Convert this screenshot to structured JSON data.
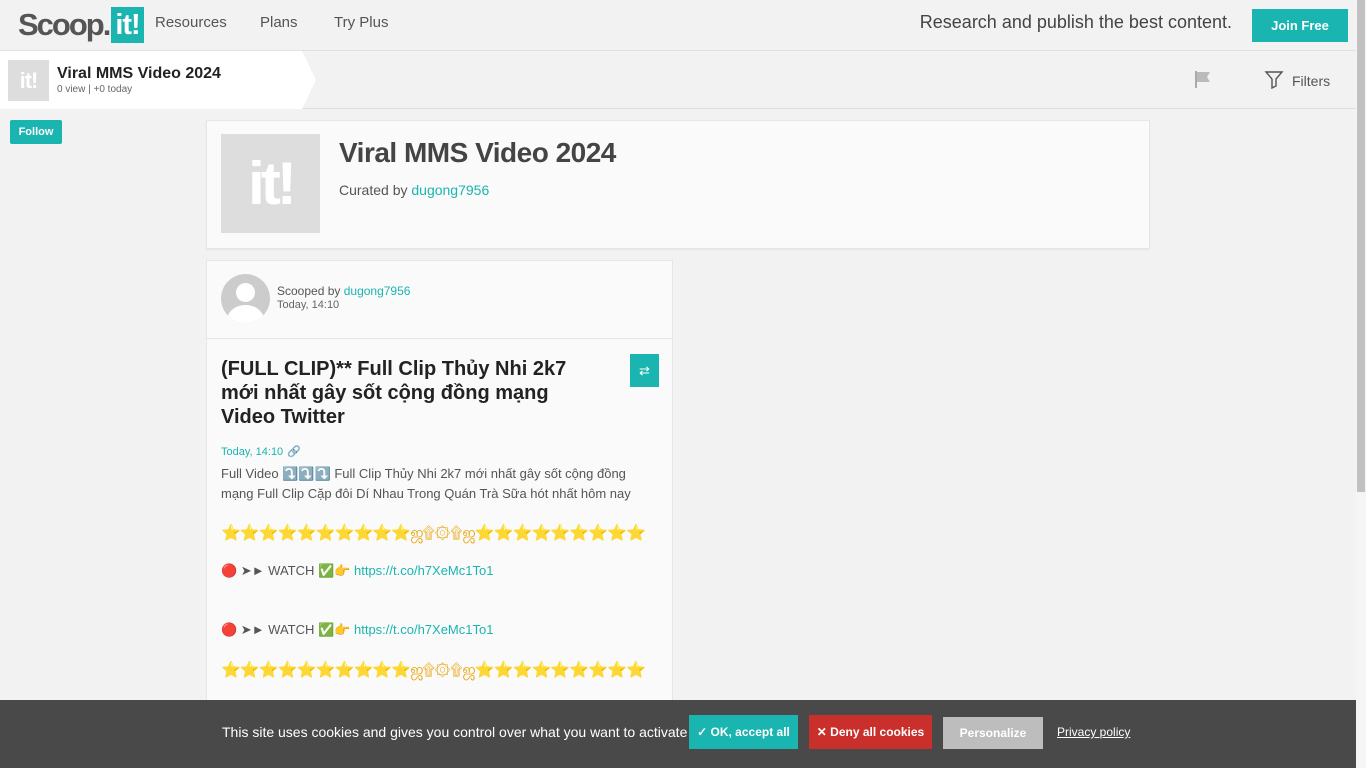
{
  "nav": {
    "logo_text": "Scoop.",
    "logo_box": "it!",
    "links": [
      "Resources",
      "Plans",
      "Try Plus"
    ],
    "tagline": "Research and publish the best content.",
    "join_label": "Join Free"
  },
  "topic": {
    "thumb_text": "it!",
    "title": "Viral MMS Video 2024",
    "stats": "0 view | +0 today",
    "filters_label": "Filters",
    "follow_label": "Follow"
  },
  "header": {
    "thumb_text": "it!",
    "title": "Viral MMS Video 2024",
    "curated_prefix": "Curated by ",
    "curator": "dugong7956"
  },
  "post": {
    "scooped_prefix": "Scooped by ",
    "scooper": "dugong7956",
    "scooped_time": "Today, 14:10",
    "title": "(FULL CLIP)** Full Clip Thủy Nhi 2k7 mới nhất gây sốt cộng đồng mạng Video Twitter",
    "date": "Today, 14:10",
    "description": "Full Video ⤵️⤵️⤵️ Full Clip Thủy Nhi 2k7 mới nhất gây sốt cộng đồng mạng Full Clip Cặp đôi Dí Nhau Trong Quán Trà Sữa hót nhất hôm nay",
    "deco_line": "⭐⭐⭐⭐⭐⭐⭐⭐⭐⭐ஜ۩۞۩ஜ⭐⭐⭐⭐⭐⭐⭐⭐⭐",
    "watch_prefix": "🔴 ➤► WATCH ✅👉 ",
    "watch_link": "https://t.co/h7XeMc1To1"
  },
  "cookie": {
    "text": "This site uses cookies and gives you control over what you want to activate",
    "ok_label": "✓ OK, accept all",
    "deny_label": "✕ Deny all cookies",
    "personalize_label": "Personalize",
    "privacy_label": "Privacy policy"
  },
  "colors": {
    "accent": "#1ab5b0",
    "deny": "#c9302c",
    "banner": "#494949"
  }
}
